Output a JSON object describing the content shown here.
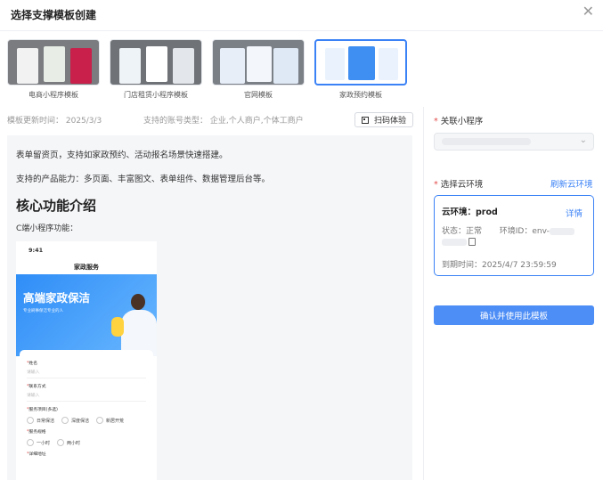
{
  "dialog": {
    "title": "选择支撑模板创建",
    "close_icon": "close-icon"
  },
  "templates": [
    {
      "label": "电商小程序模板",
      "selected": false
    },
    {
      "label": "门店租赁小程序模板",
      "selected": false
    },
    {
      "label": "官网模板",
      "selected": false
    },
    {
      "label": "家政预约模板",
      "selected": true
    }
  ],
  "meta": {
    "updated": "模板更新时间：  2025/3/3",
    "accounts": "支持的账号类型：  企业,个人商户,个体工商户",
    "scan_button": "扫码体验"
  },
  "content": {
    "intro": "表单留资页，支持如家政预约、活动报名场景快速搭建。",
    "abilities": "支持的产品能力：多页面、丰富图文、表单组件、数据管理后台等。",
    "heading": "核心功能介绍",
    "sub": "C端小程序功能：",
    "phone": {
      "time": "9:41",
      "title": "家政服务",
      "banner_title": "高端家政保洁",
      "banner_sub": "专业刷事保洁专业的人",
      "form": {
        "name_label": "姓名",
        "name_placeholder": "请输入",
        "contact_label": "联系方式",
        "contact_placeholder": "请输入",
        "service_label": "服务项目(多选)",
        "service_options": [
          "日常保洁",
          "深度保洁",
          "新居开荒"
        ],
        "duration_label": "服务规格",
        "duration_options": [
          "一小时",
          "两小时"
        ],
        "address_label": "详细地址"
      }
    }
  },
  "side": {
    "mini_program_label": "关联小程序",
    "cloud_env_label": "选择云环境",
    "refresh_link": "刷新云环境",
    "env": {
      "name": "云环境：prod",
      "detail_link": "详情",
      "status": "状态：正常",
      "env_id_label": "环境ID：env-",
      "expire": "到期时间：2025/4/7 23:59:59"
    },
    "confirm_button": "确认并使用此模板"
  },
  "colors": {
    "accent": "#3b82f6",
    "required": "#e34d4d",
    "content_bg": "#f5f6f8"
  }
}
